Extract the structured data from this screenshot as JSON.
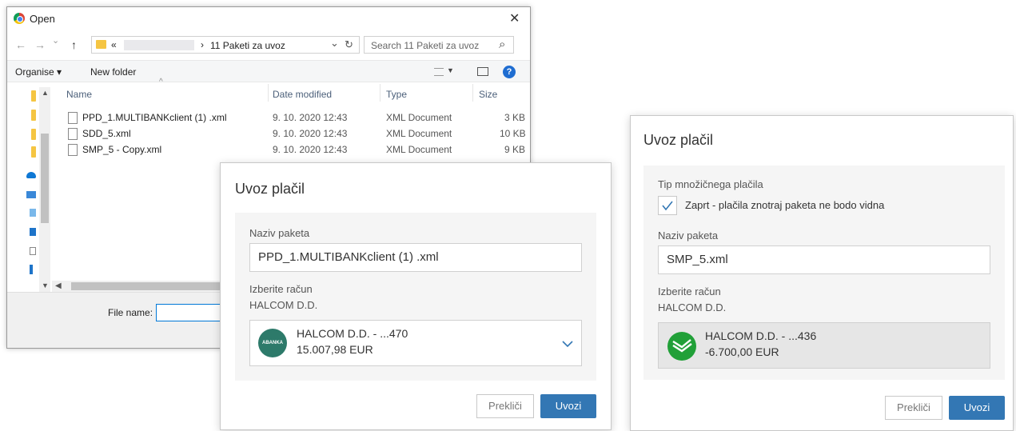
{
  "file_dialog": {
    "title": "Open",
    "close_glyph": "✕",
    "nav": {
      "back": "←",
      "forward": "→",
      "recent": "⌄",
      "up": "↑"
    },
    "address": {
      "prefix": "«",
      "separator": "›",
      "current": "11 Paketi za uvoz",
      "dropdown": "⌄",
      "refresh": "↻"
    },
    "search_placeholder": "Search 11 Paketi za uvoz",
    "search_icon": "⌕",
    "toolbar": {
      "organise": "Organise ▾",
      "new_folder": "New folder",
      "help": "?"
    },
    "columns": {
      "name": "Name",
      "date": "Date modified",
      "type": "Type",
      "size": "Size"
    },
    "files": [
      {
        "name": "PPD_1.MULTIBANKclient  (1) .xml",
        "date": "9. 10. 2020 12:43",
        "type": "XML Document",
        "size": "3 KB"
      },
      {
        "name": "SDD_5.xml",
        "date": "9. 10. 2020 12:43",
        "type": "XML Document",
        "size": "10 KB"
      },
      {
        "name": "SMP_5 - Copy.xml",
        "date": "9. 10. 2020 12:43",
        "type": "XML Document",
        "size": "9 KB"
      }
    ],
    "filename_label": "File name:",
    "filename_value": ""
  },
  "modal_left": {
    "title": "Uvoz plačil",
    "package_label": "Naziv paketa",
    "package_value": "PPD_1.MULTIBANKclient  (1) .xml",
    "account_label": "Izberite račun",
    "account_owner": "HALCOM D.D.",
    "account": {
      "name": "HALCOM D.D. - ...470",
      "amount": "15.007,98 EUR",
      "bank_logo_text": "ABANKA",
      "logo_color": "#2d7a6a"
    },
    "cancel": "Prekliči",
    "ok": "Uvozi"
  },
  "modal_right": {
    "title": "Uvoz plačil",
    "type_label": "Tip množičnega plačila",
    "checkbox_label": "Zaprt - plačila znotraj paketa ne bodo vidna",
    "checkbox_checked": true,
    "package_label": "Naziv paketa",
    "package_value": "SMP_5.xml",
    "account_label": "Izberite račun",
    "account_owner": "HALCOM D.D.",
    "account": {
      "name": "HALCOM D.D. - ...436",
      "amount": "-6.700,00 EUR",
      "logo_color": "#21a038"
    },
    "cancel": "Prekliči",
    "ok": "Uvozi"
  }
}
